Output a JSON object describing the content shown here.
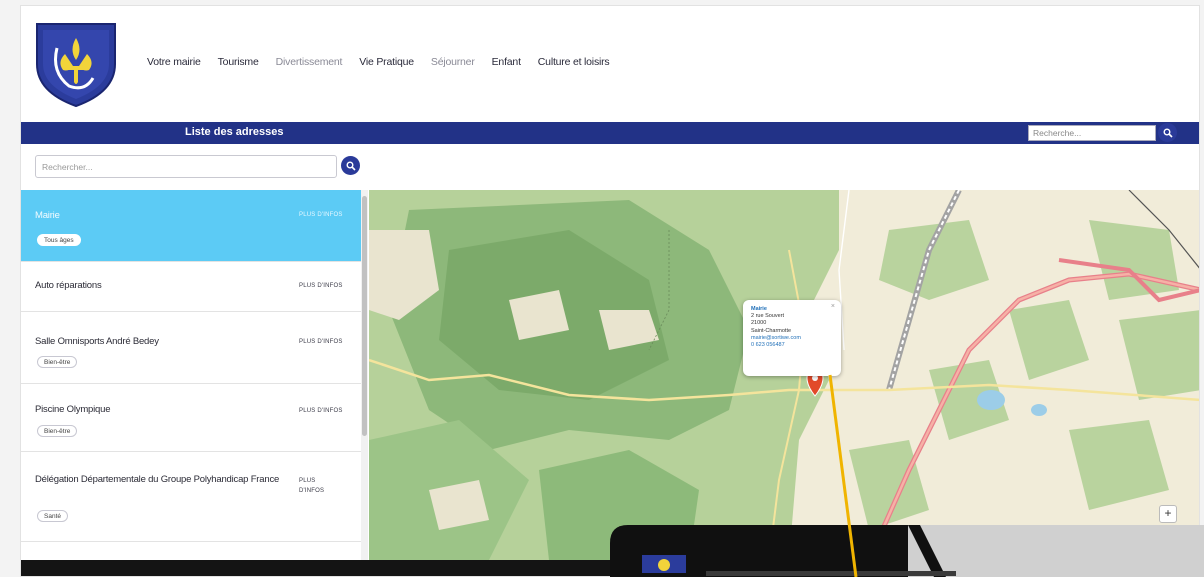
{
  "header": {
    "nav": [
      {
        "label": "Votre mairie",
        "muted": false
      },
      {
        "label": "Tourisme",
        "muted": false
      },
      {
        "label": "Divertissement",
        "muted": true
      },
      {
        "label": "Vie Pratique",
        "muted": false
      },
      {
        "label": "Séjourner",
        "muted": true
      },
      {
        "label": "Enfant",
        "muted": false
      },
      {
        "label": "Culture et loisirs",
        "muted": false
      }
    ]
  },
  "bar": {
    "title": "Liste des adresses",
    "search_placeholder": "Recherche..."
  },
  "sidebar": {
    "search_placeholder": "Rechercher...",
    "items": [
      {
        "name": "Mairie",
        "more": "PLUS D'INFOS",
        "tag": "Tous âges",
        "active": true
      },
      {
        "name": "Auto réparations",
        "more": "PLUS D'INFOS",
        "tag": "",
        "active": false
      },
      {
        "name": "Salle Omnisports André Bedey",
        "more": "PLUS D'INFOS",
        "tag": "Bien-être",
        "active": false
      },
      {
        "name": "Piscine Olympique",
        "more": "PLUS D'INFOS",
        "tag": "Bien-être",
        "active": false
      },
      {
        "name": "Délégation Départementale du Groupe Polyhandicap France",
        "more": "PLUS D'INFOS",
        "tag": "Santé",
        "active": false
      }
    ]
  },
  "map": {
    "popup": {
      "title": "Mairie",
      "line1": "2 rue Souvert",
      "line2": "21000",
      "line3": "Saint-Charmotte",
      "email": "mairie@sortiwe.com",
      "phone": "0 623 056487"
    },
    "zoom_in_label": "+"
  },
  "colors": {
    "brand": "#223287",
    "active_item": "#5ccbf5",
    "callout": "#f0b400"
  }
}
